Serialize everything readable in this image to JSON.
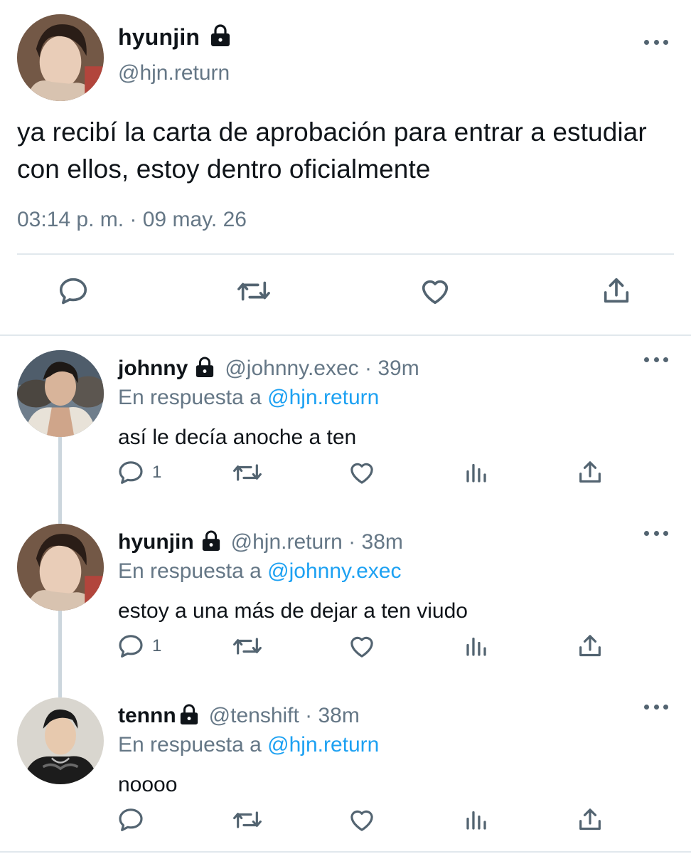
{
  "main_tweet": {
    "avatar_icon": "avatar-photo",
    "name": "hyunjin",
    "locked": true,
    "handle": "@hjn.return",
    "text": "ya recibí la carta de aprobación para entrar a estudiar con ellos, estoy dentro oficialmente",
    "timestamp": "03:14 p. m. · 09 may. 26",
    "actions": [
      "reply-icon",
      "retweet-icon",
      "like-icon",
      "share-icon"
    ]
  },
  "replies": [
    {
      "name": "johnny",
      "handle_time": "@johnny.exec · 39m",
      "reply_prefix": "En respuesta a",
      "reply_to": "@hjn.return",
      "text": "así le decía anoche a ten",
      "reply_count": "1"
    },
    {
      "name": "hyunjin",
      "handle_time": "@hjn.return · 38m",
      "reply_prefix": "En respuesta a",
      "reply_to": "@johnny.exec",
      "text": "estoy a una más de dejar a ten viudo",
      "reply_count": "1"
    },
    {
      "name": "tennn",
      "handle_time": "@tenshift · 38m",
      "reply_prefix": "En respuesta a",
      "reply_to": "@hjn.return",
      "text": "noooo",
      "reply_count": ""
    }
  ],
  "colors": {
    "link": "#1da1f2",
    "muted": "#657786",
    "icon": "#536471",
    "divider": "#e1e8ed"
  }
}
